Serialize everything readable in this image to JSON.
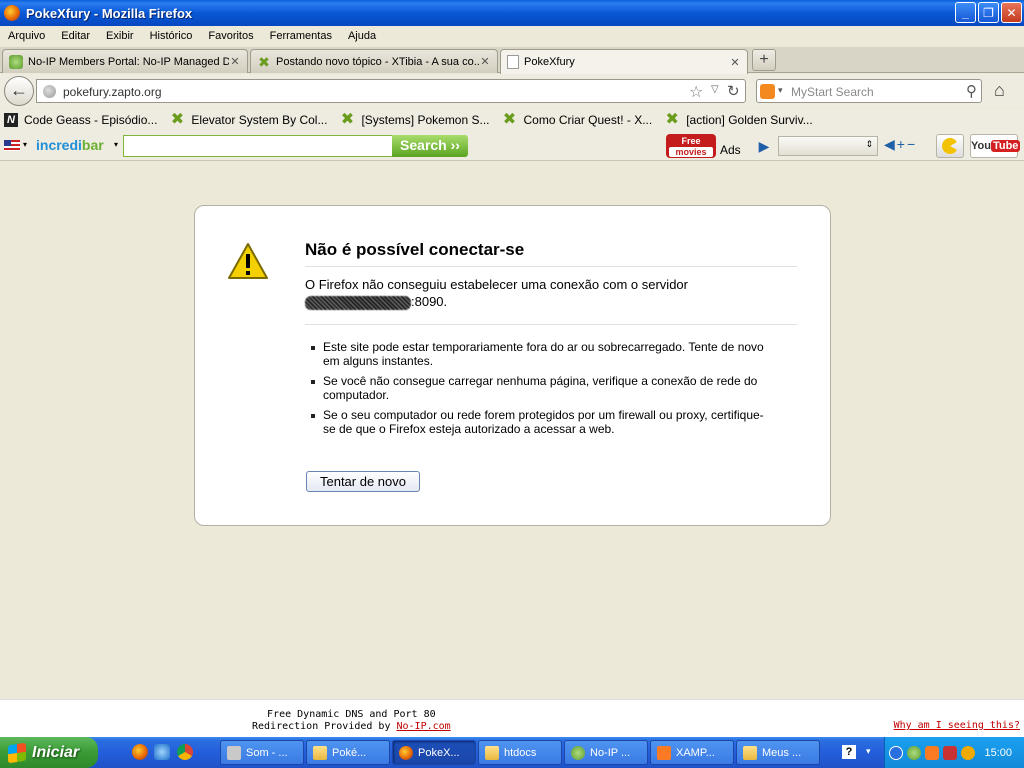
{
  "window": {
    "title": "PokeXfury - Mozilla Firefox",
    "controls": {
      "minimize": "_",
      "maximize": "❐",
      "close": "✕"
    }
  },
  "menu": [
    "Arquivo",
    "Editar",
    "Exibir",
    "Histórico",
    "Favoritos",
    "Ferramentas",
    "Ajuda"
  ],
  "tabs": [
    {
      "label": "No-IP Members Portal: No-IP Managed D...",
      "icon": "noip-icon",
      "active": false
    },
    {
      "label": "Postando novo tópico - XTibia - A sua co...",
      "icon": "xtibia-icon",
      "active": false
    },
    {
      "label": "PokeXfury",
      "icon": "blank-page-icon",
      "active": true
    }
  ],
  "tab_close": "✕",
  "new_tab": "+",
  "nav": {
    "back": "←",
    "url": "pokefury.zapto.org",
    "star": "☆",
    "dropdown": "▽",
    "reload": "↻",
    "search_placeholder": "MyStart Search",
    "search_engine_drop": "▾",
    "search_glass": "⚲",
    "home": "⌂"
  },
  "bookmarks": [
    {
      "label": "Code Geass - Episódio...",
      "icon": "n-icon"
    },
    {
      "label": "Elevator System By Col...",
      "icon": "xtibia-icon"
    },
    {
      "label": "[Systems] Pokemon S...",
      "icon": "xtibia-icon"
    },
    {
      "label": "Como Criar Quest! - X...",
      "icon": "xtibia-icon"
    },
    {
      "label": "[action] Golden Surviv...",
      "icon": "xtibia-icon"
    }
  ],
  "incredibar": {
    "brand_a": "incredi",
    "brand_b": "bar",
    "drop": "▾",
    "search_button": "Search ››",
    "free_movies_top": "Free",
    "free_movies_bottom": "movies",
    "ads": "Ads",
    "play": "▶",
    "player_drop": "⇕",
    "volume": "◀+−",
    "youtube_a": "You",
    "youtube_b": "Tube"
  },
  "error": {
    "title": "Não é possível conectar-se",
    "desc_pre": "O Firefox não conseguiu estabelecer uma conexão com o servidor",
    "desc_post": ":8090.",
    "bullets": [
      "Este site pode estar temporariamente fora do ar ou sobrecarregado. Tente de novo em alguns instantes.",
      "Se você não consegue carregar nenhuma página, verifique a conexão de rede do computador.",
      "Se o seu computador ou rede forem protegidos por um firewall ou proxy, certifique-se de que o Firefox esteja autorizado a acessar a web."
    ],
    "retry_button": "Tentar de novo"
  },
  "noip_footer": {
    "line1": "Free Dynamic DNS and Port 80",
    "line2_pre": "Redirection Provided by ",
    "link": "No-IP.com",
    "why": "Why am I seeing this?"
  },
  "taskbar": {
    "start": "Iniciar",
    "tasks": [
      {
        "label": "Som - ...",
        "icon": "speaker-icon",
        "active": false
      },
      {
        "label": "Poké...",
        "icon": "folder-icon",
        "active": false
      },
      {
        "label": "PokeX...",
        "icon": "firefox-icon",
        "active": true
      },
      {
        "label": "htdocs",
        "icon": "folder-icon",
        "active": false
      },
      {
        "label": "No-IP ...",
        "icon": "noip-icon",
        "active": false
      },
      {
        "label": "XAMP...",
        "icon": "xampp-icon",
        "active": false
      },
      {
        "label": "Meus ...",
        "icon": "folder-icon",
        "active": false
      }
    ],
    "help": "?",
    "tray_drop": "▾",
    "clock": "15:00"
  },
  "colors": {
    "titlebar": "#0858d6",
    "taskbar": "#245edb",
    "start_green": "#3a9a35",
    "link_red": "#c00000",
    "incredibar_green": "#5ba322"
  }
}
